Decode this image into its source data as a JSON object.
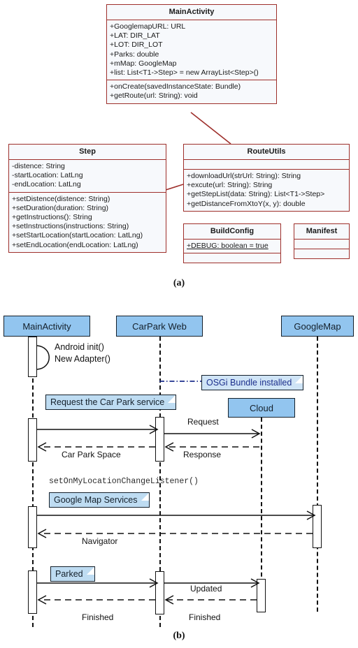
{
  "figures": {
    "a_caption": "(a)",
    "b_caption": "(b)"
  },
  "class_diagram": {
    "classes": [
      {
        "name": "MainActivity",
        "attributes": [
          "+GooglemapURL: URL",
          "+LAT: DIR_LAT",
          "+LOT: DIR_LOT",
          "+Parks: double",
          "+mMap: GoogleMap",
          "+list: List<T1->Step> = new ArrayList<Step>()"
        ],
        "methods": [
          "+onCreate(savedInstanceState: Bundle)",
          "+getRoute(url: String): void"
        ]
      },
      {
        "name": "Step",
        "attributes": [
          "-distence: String",
          "-startLocation: LatLng",
          "-endLocation: LatLng"
        ],
        "methods": [
          "+setDistence(distence: String)",
          "+setDuration(duration: String)",
          "+getInstructions(): String",
          "+setInstructions(instructions: String)",
          "+setStartLocation(startLocation: LatLng)",
          "+setEndLocation(endLocation: LatLng)"
        ]
      },
      {
        "name": "RouteUtils",
        "attributes": [],
        "methods": [
          "+downloadUrl(strUrl: String): String",
          "+excute(url: String): String",
          "+getStepList(data: String): List<T1->Step>",
          "+getDistanceFromXtoY(x, y): double"
        ]
      },
      {
        "name": "BuildConfig",
        "attributes": [
          "+DEBUG: boolean = true"
        ],
        "methods": []
      },
      {
        "name": "Manifest",
        "attributes": [],
        "methods": []
      }
    ],
    "colors": {
      "border": "#9e2f2b",
      "fill": "#f7f9fc"
    }
  },
  "sequence_diagram": {
    "actors": [
      {
        "label": "MainActivity"
      },
      {
        "label": "CarPark Web"
      },
      {
        "label": "Cloud"
      },
      {
        "label": "GoogleMap"
      }
    ],
    "self_message": {
      "line1": "Android init()",
      "line2": "New Adapter()"
    },
    "notes": [
      {
        "label": "OSGi Bundle installed"
      },
      {
        "label": "Request the Car Park service"
      },
      {
        "label": "Google Map Services"
      },
      {
        "label": "Parked"
      }
    ],
    "code_label": "setOnMyLocationChangeListener()",
    "messages": [
      {
        "label": "Request"
      },
      {
        "label": "Car Park Space"
      },
      {
        "label": "Response"
      },
      {
        "label": "Navigator"
      },
      {
        "label": "Updated"
      },
      {
        "label": "Finished"
      },
      {
        "label": "Finished"
      }
    ],
    "colors": {
      "actor_fill": "#92c5ef",
      "note_fill": "#bedcf2",
      "osgi_text": "#1c2f8c",
      "stroke": "#111111"
    }
  }
}
